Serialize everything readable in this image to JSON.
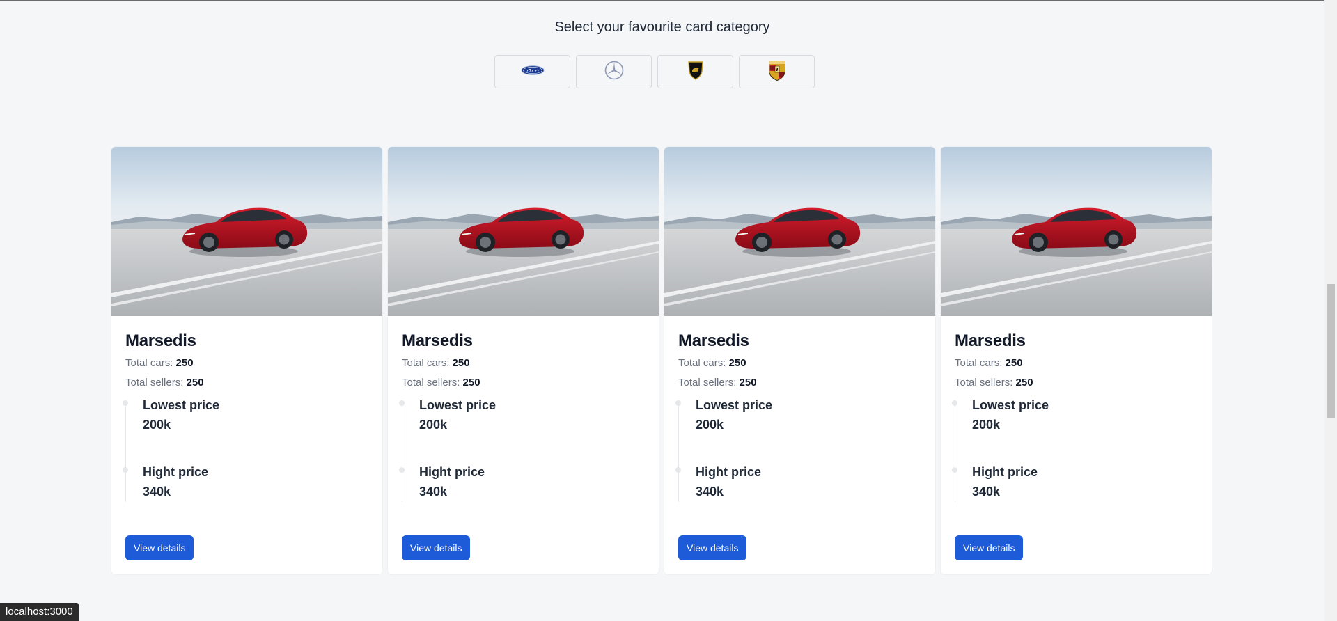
{
  "section": {
    "heading": "Select your favourite card category"
  },
  "brands": [
    {
      "name": "ford-icon",
      "label": "Ford"
    },
    {
      "name": "mercedes-icon",
      "label": "Mercedes"
    },
    {
      "name": "lamborghini-icon",
      "label": "Lamborghini"
    },
    {
      "name": "porsche-icon",
      "label": "Porsche"
    }
  ],
  "cards": [
    {
      "title": "Marsedis",
      "total_cars_label": "Total cars:",
      "total_cars": "250",
      "total_sellers_label": "Total sellers:",
      "total_sellers": "250",
      "lowest_label": "Lowest price",
      "lowest_value": "200k",
      "highest_label": "Hight price",
      "highest_value": "340k",
      "button": "View details"
    },
    {
      "title": "Marsedis",
      "total_cars_label": "Total cars:",
      "total_cars": "250",
      "total_sellers_label": "Total sellers:",
      "total_sellers": "250",
      "lowest_label": "Lowest price",
      "lowest_value": "200k",
      "highest_label": "Hight price",
      "highest_value": "340k",
      "button": "View details"
    },
    {
      "title": "Marsedis",
      "total_cars_label": "Total cars:",
      "total_cars": "250",
      "total_sellers_label": "Total sellers:",
      "total_sellers": "250",
      "lowest_label": "Lowest price",
      "lowest_value": "200k",
      "highest_label": "Hight price",
      "highest_value": "340k",
      "button": "View details"
    },
    {
      "title": "Marsedis",
      "total_cars_label": "Total cars:",
      "total_cars": "250",
      "total_sellers_label": "Total sellers:",
      "total_sellers": "250",
      "lowest_label": "Lowest price",
      "lowest_value": "200k",
      "highest_label": "Hight price",
      "highest_value": "340k",
      "button": "View details"
    }
  ],
  "status_bar": {
    "url": "localhost:3000"
  },
  "colors": {
    "accent": "#1d5bd8",
    "background": "#f5f6f8",
    "car_red": "#b3121f"
  }
}
